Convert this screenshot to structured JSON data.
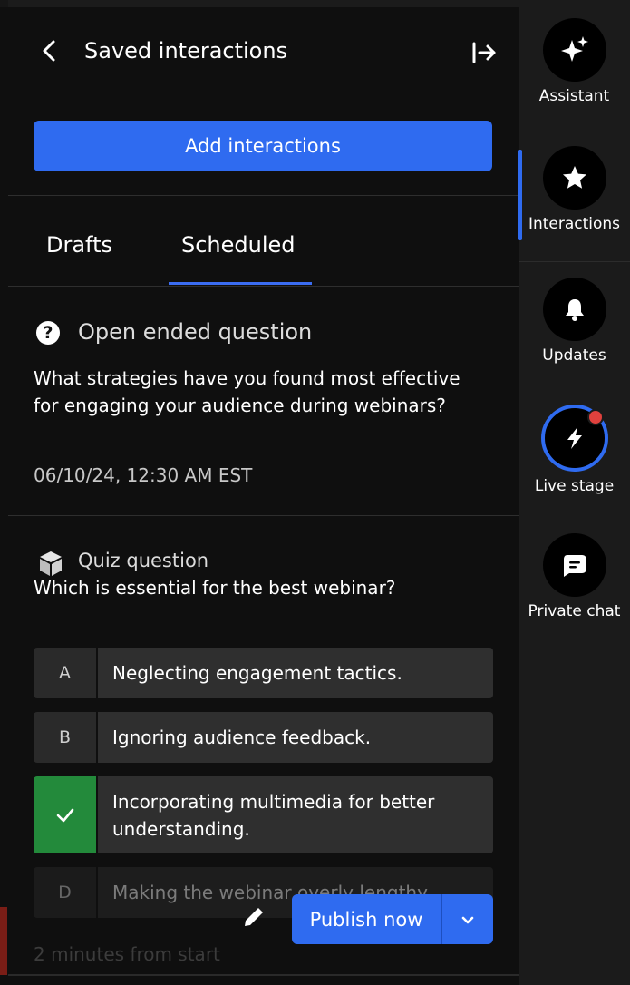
{
  "header": {
    "title": "Saved interactions",
    "back_icon": "chevron-left-icon",
    "exit_icon": "arrow-right-to-bar-icon"
  },
  "add_button": "Add interactions",
  "tabs": [
    {
      "label": "Drafts",
      "active": false
    },
    {
      "label": "Scheduled",
      "active": true
    }
  ],
  "open_question": {
    "type_label": "Open ended question",
    "icon": "question-circle-icon",
    "text": "What strategies have you found most effective for engaging your audience during webinars?",
    "date": "06/10/24, 12:30 AM EST"
  },
  "quiz": {
    "type_label": "Quiz question",
    "icon": "cube-icon",
    "text": "Which is essential for the best webinar?",
    "options": [
      {
        "letter": "A",
        "text": "Neglecting engagement tactics.",
        "correct": false
      },
      {
        "letter": "B",
        "text": "Ignoring audience feedback.",
        "correct": false
      },
      {
        "letter": "C",
        "text": "Incorporating multimedia for better understanding.",
        "correct": true
      },
      {
        "letter": "D",
        "text": "Making the webinar overly lengthy.",
        "correct": false
      }
    ],
    "timing": "2 minutes from start"
  },
  "actions": {
    "publish_label": "Publish now",
    "edit_icon": "pencil-icon",
    "dropdown_icon": "chevron-down-icon"
  },
  "rail": {
    "active_index": 1,
    "items": [
      {
        "label": "Assistant",
        "icon": "sparkles-icon"
      },
      {
        "label": "Interactions",
        "icon": "star-icon"
      },
      {
        "label": "Updates",
        "icon": "bell-icon"
      },
      {
        "label": "Live stage",
        "icon": "lightning-icon",
        "badge": true
      },
      {
        "label": "Private chat",
        "icon": "chat-bubble-icon"
      }
    ]
  },
  "colors": {
    "accent": "#2f6bf0",
    "correct": "#238a3b",
    "badge": "#e0413d"
  }
}
